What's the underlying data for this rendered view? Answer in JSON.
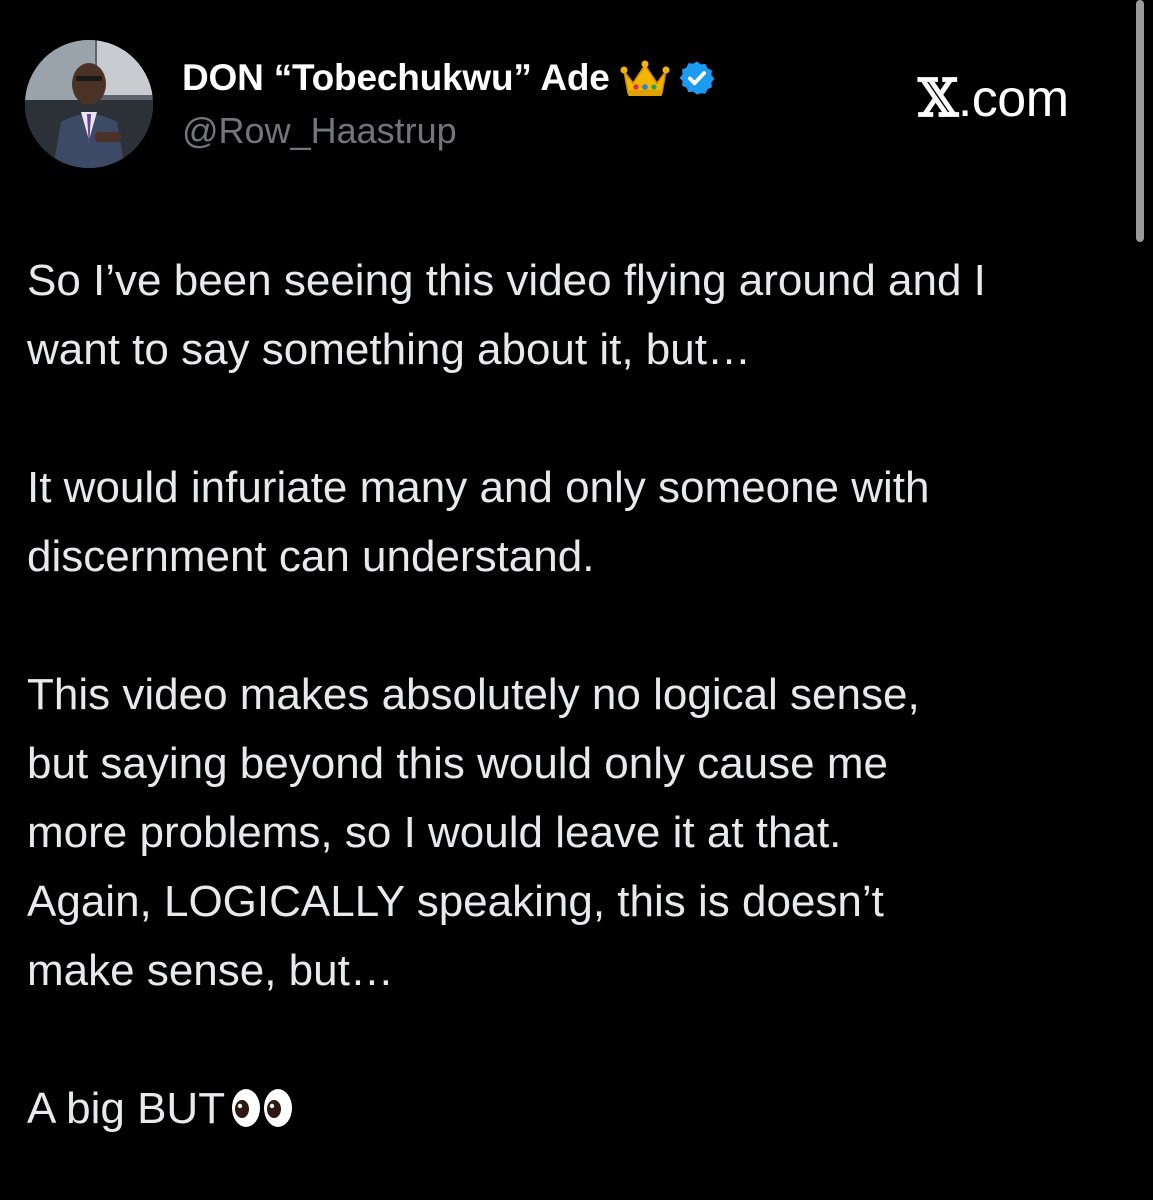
{
  "tweet": {
    "author": {
      "display_name": "DON “Tobechukwu” Ade",
      "handle": "@Row_Haastrup",
      "badges": [
        "crown-emoji",
        "verified-badge"
      ]
    },
    "brand": {
      "x_mark": "𝕏",
      "domain": ".com"
    },
    "paragraphs": [
      "So I’ve been seeing this video flying around and I\nwant to say something about it, but…",
      "It would infuriate many and only someone with\ndiscernment can understand.",
      "This video makes absolutely no logical sense,\nbut saying beyond this would only cause me\nmore problems, so I would leave it at that.\nAgain, LOGICALLY speaking, this is doesn’t\nmake sense, but…",
      "A big BUT"
    ],
    "closing_emoji": "eyes"
  },
  "colors": {
    "background": "#000000",
    "text": "#e7e9ea",
    "handle": "#71767b",
    "verified": "#1d9bf0"
  }
}
